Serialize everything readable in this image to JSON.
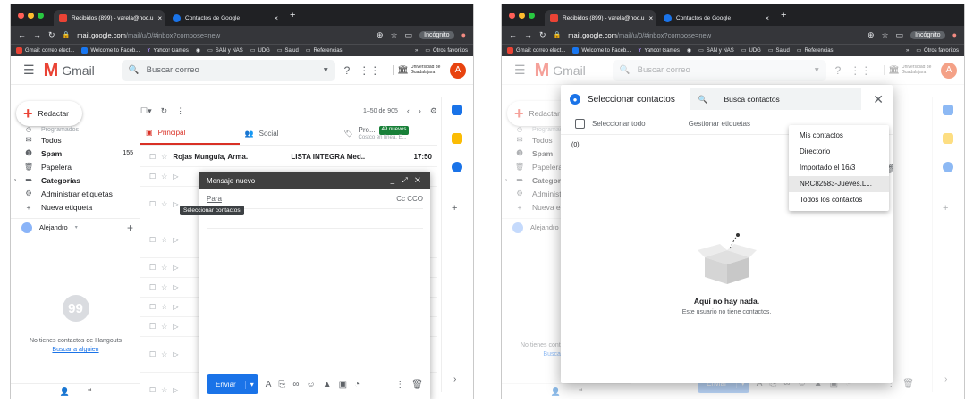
{
  "browser": {
    "tab1": "Recibidos (899) - varela@noc.u",
    "tab2": "Contactos de Google",
    "url_host": "mail.google.com",
    "url_path": "/mail/u/0/#inbox?compose=new",
    "incognito": "Incógnito",
    "bookmarks": [
      "Gmail: correo elect...",
      "Welcome to Faceb...",
      "Yahoo! Games",
      "SAN y NAS",
      "UDG",
      "Salud",
      "Referencias"
    ],
    "other_favs": "Otros favoritos",
    "chevrons": "»"
  },
  "gmail": {
    "logo": "Gmail",
    "search_placeholder": "Buscar correo",
    "org": "Universidad de Guadalajara",
    "avatar": "A",
    "compose": "Redactar",
    "sidebar": [
      {
        "label": "Programados",
        "icon": "clock-icon",
        "count": ""
      },
      {
        "label": "Todos",
        "icon": "mail-icon",
        "count": ""
      },
      {
        "label": "Spam",
        "icon": "spam-icon",
        "count": "155",
        "bold": true
      },
      {
        "label": "Papelera",
        "icon": "trash-icon",
        "count": ""
      },
      {
        "label": "Categorías",
        "icon": "label-icon",
        "count": "",
        "bold": true
      },
      {
        "label": "Administrar etiquetas",
        "icon": "gear-icon",
        "count": ""
      },
      {
        "label": "Nueva etiqueta",
        "icon": "plus-icon",
        "count": ""
      }
    ],
    "user": "Alejandro",
    "hangouts_empty": "No tienes contactos de Hangouts",
    "hangouts_link": "Buscar a alguien",
    "range": "1–50 de 905",
    "tabs": {
      "principal": "Principal",
      "social": "Social",
      "promos": "Pro...",
      "promos_sub": "Costco en línea, E...",
      "new_badge": "49 nuevos"
    },
    "rows": [
      {
        "from": "Rojas Munguía, Arma.",
        "subject": "LISTA INTEGRA Med..",
        "time": "17:50"
      }
    ]
  },
  "compose_win": {
    "title": "Mensaje nuevo",
    "to": "Para",
    "cc": "Cc CCO",
    "send": "Enviar",
    "tooltip": "Seleccionar contactos"
  },
  "dialog": {
    "title": "Seleccionar contactos",
    "search_label": "Busca contactos",
    "select_all": "Seleccionar todo",
    "manage_labels": "Gestionar etiquetas",
    "count": "(0)",
    "empty_title": "Aquí no hay nada.",
    "empty_sub": "Este usuario no tiene contactos.",
    "menu": [
      "Mis contactos",
      "Directorio",
      "Importado el 16/3",
      "NRC82583-Jueves.L...",
      "Todos los contactos"
    ]
  },
  "colors": {
    "gmail_red": "#d93025",
    "accent_blue": "#1a73e8",
    "green_badge": "#188038"
  }
}
